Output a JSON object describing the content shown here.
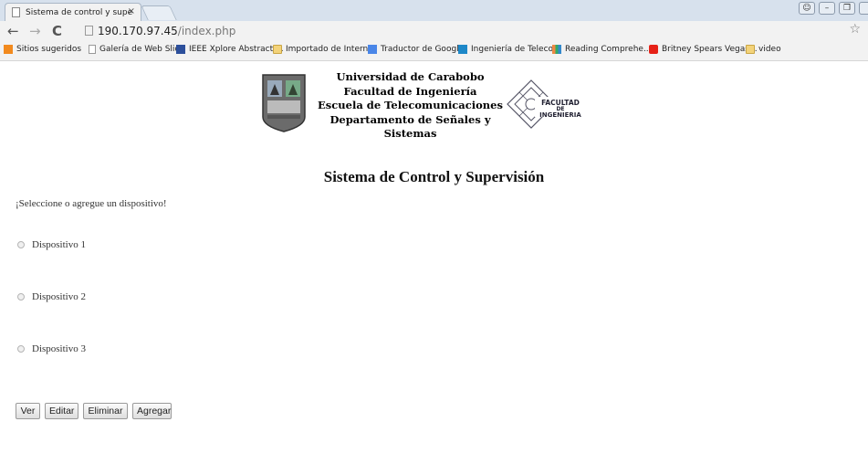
{
  "browser": {
    "tab_title": "Sistema de control y supe",
    "tab_close": "×",
    "url_host": "190.170.97.45",
    "url_path": "/index.php",
    "bookmarks": [
      {
        "label": "Sitios sugeridos",
        "icon": "bing-icon"
      },
      {
        "label": "Galería de Web Slice",
        "icon": "page-icon"
      },
      {
        "label": "IEEE Xplore Abstract ...",
        "icon": "grid-icon"
      },
      {
        "label": "Importado de Intern...",
        "icon": "folder-icon"
      },
      {
        "label": "Traductor de Google",
        "icon": "translate-icon"
      },
      {
        "label": "Ingeniería de Teleco...",
        "icon": "ieee-icon"
      },
      {
        "label": "Reading Comprehe...",
        "icon": "bars-icon"
      },
      {
        "label": "Britney Spears Vegas...",
        "icon": "youtube-icon"
      },
      {
        "label": "video",
        "icon": "folder-icon"
      }
    ]
  },
  "header": {
    "lines": [
      "Universidad de Carabobo",
      "Facultad de Ingeniería",
      "Escuela de Telecomunicaciones",
      "Departamento de Señales y Sistemas"
    ],
    "logo_text": [
      "FACULTAD",
      "DE",
      "INGENIERIA"
    ]
  },
  "page": {
    "title": "Sistema de Control y Supervisión",
    "prompt": "¡Seleccione o agregue un dispositivo!",
    "devices": [
      "Dispositivo 1",
      "Dispositivo 2",
      "Dispositivo 3"
    ],
    "buttons": {
      "ver": "Ver",
      "editar": "Editar",
      "eliminar": "Eliminar",
      "agregar": "Agregar"
    }
  }
}
